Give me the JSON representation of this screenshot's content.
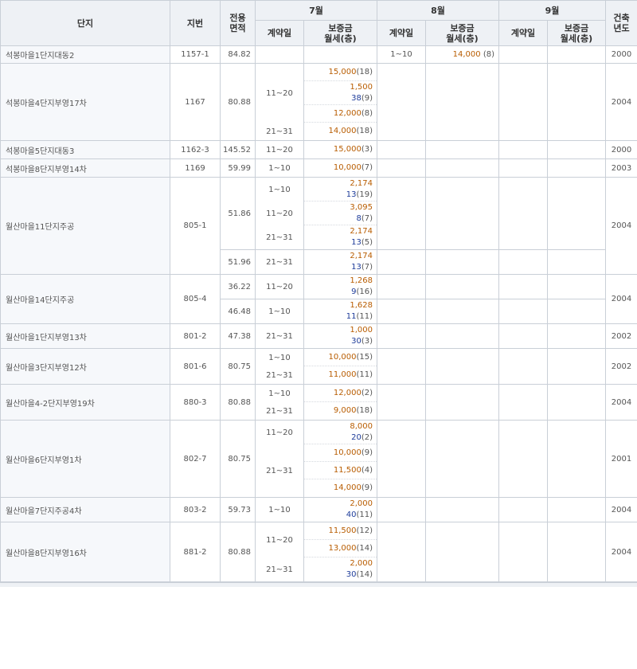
{
  "headers": {
    "danji": "단지",
    "jibun": "지번",
    "area": "전용\n면적",
    "months": [
      "7월",
      "8월",
      "9월"
    ],
    "contract_day": "계약일",
    "deposit_rent": "보증금\n월세(층)",
    "built_year": "건축\n년도"
  },
  "rows": [
    {
      "name": "석봉마을1단지대동2",
      "jibun": "1157-1",
      "area": "84.82",
      "year": "2000",
      "aug": {
        "day": "1~10",
        "deposit": "14,000",
        "count": "(8)"
      }
    },
    {
      "name": "석봉마을4단지부영17차",
      "jibun": "1167",
      "area": "80.88",
      "year": "2004",
      "jul": [
        {
          "day": "11~20",
          "entries": [
            {
              "deposit": "15,000",
              "count": "(18)"
            },
            {
              "deposit": "1,500",
              "rent": "38",
              "count": "(9)"
            },
            {
              "deposit": "12,000",
              "count": "(8)"
            }
          ]
        },
        {
          "day": "21~31",
          "entries": [
            {
              "deposit": "14,000",
              "count": "(18)"
            }
          ]
        }
      ]
    },
    {
      "name": "석봉마을5단지대동3",
      "jibun": "1162-3",
      "area": "145.52",
      "year": "2000",
      "jul": [
        {
          "day": "11~20",
          "entries": [
            {
              "deposit": "15,000",
              "count": "(3)"
            }
          ]
        }
      ]
    },
    {
      "name": "석봉마을8단지부영14차",
      "jibun": "1169",
      "area": "59.99",
      "year": "2003",
      "jul": [
        {
          "day": "1~10",
          "entries": [
            {
              "deposit": "10,000",
              "count": "(7)"
            }
          ]
        }
      ]
    },
    {
      "name": "월산마을11단지주공",
      "jibun": "805-1",
      "year": "2004",
      "sub": [
        {
          "area": "51.86",
          "jul": [
            {
              "day": "1~10",
              "entries": [
                {
                  "deposit": "2,174",
                  "rent": "13",
                  "count": "(19)"
                }
              ]
            },
            {
              "day": "11~20",
              "entries": [
                {
                  "deposit": "3,095",
                  "rent": "8",
                  "count": "(7)"
                }
              ]
            },
            {
              "day": "21~31",
              "entries": [
                {
                  "deposit": "2,174",
                  "rent": "13",
                  "count": "(5)"
                }
              ]
            }
          ]
        },
        {
          "area": "51.96",
          "jul": [
            {
              "day": "21~31",
              "entries": [
                {
                  "deposit": "2,174",
                  "rent": "13",
                  "count": "(7)"
                }
              ]
            }
          ]
        }
      ]
    },
    {
      "name": "월산마을14단지주공",
      "jibun": "805-4",
      "year": "2004",
      "sub": [
        {
          "area": "36.22",
          "jul": [
            {
              "day": "11~20",
              "entries": [
                {
                  "deposit": "1,268",
                  "rent": "9",
                  "count": "(16)"
                }
              ]
            }
          ]
        },
        {
          "area": "46.48",
          "jul": [
            {
              "day": "1~10",
              "entries": [
                {
                  "deposit": "1,628",
                  "rent": "11",
                  "count": "(11)"
                }
              ]
            }
          ]
        }
      ]
    },
    {
      "name": "월산마을1단지부영13차",
      "jibun": "801-2",
      "area": "47.38",
      "year": "2002",
      "jul": [
        {
          "day": "21~31",
          "entries": [
            {
              "deposit": "1,000",
              "rent": "30",
              "count": "(3)"
            }
          ]
        }
      ]
    },
    {
      "name": "월산마을3단지부영12차",
      "jibun": "801-6",
      "area": "80.75",
      "year": "2002",
      "jul": [
        {
          "day": "1~10",
          "entries": [
            {
              "deposit": "10,000",
              "count": "(15)"
            }
          ]
        },
        {
          "day": "21~31",
          "entries": [
            {
              "deposit": "11,000",
              "count": "(11)"
            }
          ]
        }
      ]
    },
    {
      "name": "월산마을4-2단지부영19차",
      "jibun": "880-3",
      "area": "80.88",
      "year": "2004",
      "jul": [
        {
          "day": "1~10",
          "entries": [
            {
              "deposit": "12,000",
              "count": "(2)"
            }
          ]
        },
        {
          "day": "21~31",
          "entries": [
            {
              "deposit": "9,000",
              "count": "(18)"
            }
          ]
        }
      ]
    },
    {
      "name": "월산마을6단지부영1차",
      "jibun": "802-7",
      "area": "80.75",
      "year": "2001",
      "jul": [
        {
          "day": "11~20",
          "entries": [
            {
              "deposit": "8,000",
              "rent": "20",
              "count": "(2)"
            }
          ]
        },
        {
          "day": "21~31",
          "entries": [
            {
              "deposit": "10,000",
              "count": "(9)"
            },
            {
              "deposit": "11,500",
              "count": "(4)"
            },
            {
              "deposit": "14,000",
              "count": "(9)"
            }
          ]
        }
      ]
    },
    {
      "name": "월산마을7단지주공4차",
      "jibun": "803-2",
      "area": "59.73",
      "year": "2004",
      "jul": [
        {
          "day": "1~10",
          "entries": [
            {
              "deposit": "2,000",
              "rent": "40",
              "count": "(11)"
            }
          ]
        }
      ]
    },
    {
      "name": "월산마을8단지부영16차",
      "jibun": "881-2",
      "area": "80.88",
      "year": "2004",
      "jul": [
        {
          "day": "11~20",
          "entries": [
            {
              "deposit": "11,500",
              "count": "(12)"
            },
            {
              "deposit": "13,000",
              "count": "(14)"
            }
          ]
        },
        {
          "day": "21~31",
          "entries": [
            {
              "deposit": "2,000",
              "rent": "30",
              "count": "(14)"
            }
          ]
        }
      ]
    }
  ]
}
